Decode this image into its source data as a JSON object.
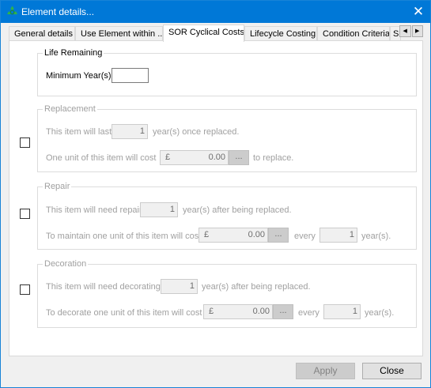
{
  "window": {
    "title": "Element details...",
    "close_glyph": "✕",
    "app_icon": "recycle-icon",
    "accent": "#0078d7"
  },
  "tabs": [
    {
      "label": "General details"
    },
    {
      "label": "Use Element within .."
    },
    {
      "label": "SOR Cyclical Costs",
      "active": true
    },
    {
      "label": "Lifecycle Costing"
    },
    {
      "label": "Condition Criteria"
    },
    {
      "label": "S"
    }
  ],
  "tab_scroll": {
    "left": "◀",
    "right": "▶"
  },
  "life_remaining": {
    "legend": "Life Remaining",
    "min_years_label": "Minimum Year(s)",
    "min_years_value": ""
  },
  "replacement": {
    "legend": "Replacement",
    "last_label": "This item will last",
    "last_value": "1",
    "last_suffix": "year(s) once replaced.",
    "cost_label": "One unit of this item will cost",
    "currency": "£",
    "cost_value": "0.00",
    "ellipsis": "...",
    "cost_suffix": "to replace."
  },
  "repair": {
    "legend": "Repair",
    "need_label": "This item will need repair",
    "need_value": "1",
    "need_suffix": "year(s) after being replaced.",
    "cost_label": "To maintain one unit of this item will cost",
    "currency": "£",
    "cost_value": "0.00",
    "ellipsis": "...",
    "every_label": "every",
    "every_value": "1",
    "every_suffix": "year(s)."
  },
  "decoration": {
    "legend": "Decoration",
    "need_label": "This item will need decorating",
    "need_value": "1",
    "need_suffix": "year(s) after being replaced.",
    "cost_label": "To decorate one unit of this item will cost",
    "currency": "£",
    "cost_value": "0.00",
    "ellipsis": "...",
    "every_label": "every",
    "every_value": "1",
    "every_suffix": "year(s)."
  },
  "buttons": {
    "apply": "Apply",
    "close": "Close"
  }
}
